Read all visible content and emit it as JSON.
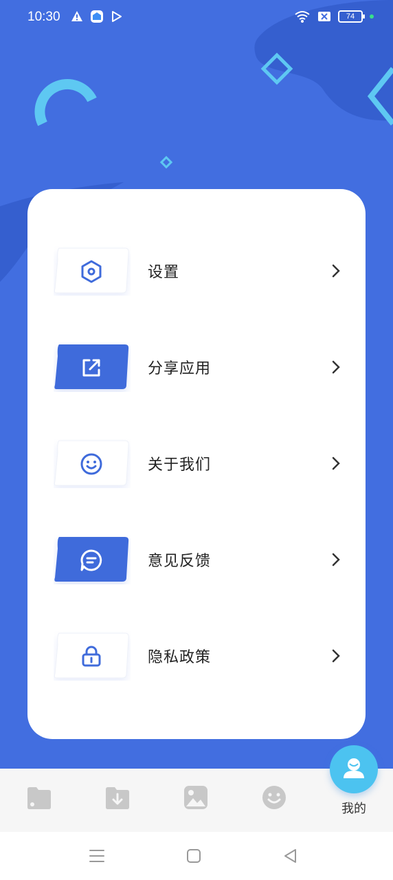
{
  "status_bar": {
    "time": "10:30",
    "battery_level": "74",
    "left_icons": [
      "warning-icon",
      "store-badge-icon",
      "play-store-icon"
    ],
    "right_icons": [
      "wifi-icon",
      "sim-off-icon",
      "battery-icon",
      "charging-dot"
    ]
  },
  "colors": {
    "background": "#426ee0",
    "accent": "#3f6bdb",
    "tab_me_bubble": "#4cc3f0",
    "inactive_tab": "#c8c8c8"
  },
  "menu": {
    "items": [
      {
        "label": "设置",
        "icon": "hexagon-settings-icon",
        "style": "outline"
      },
      {
        "label": "分享应用",
        "icon": "share-external-icon",
        "style": "filled"
      },
      {
        "label": "关于我们",
        "icon": "smiley-face-icon",
        "style": "outline"
      },
      {
        "label": "意见反馈",
        "icon": "chat-bubble-icon",
        "style": "filled"
      },
      {
        "label": "隐私政策",
        "icon": "lock-icon",
        "style": "outline"
      }
    ]
  },
  "tab_bar": {
    "tabs": [
      {
        "icon": "folder-icon"
      },
      {
        "icon": "download-folder-icon"
      },
      {
        "icon": "image-icon"
      },
      {
        "icon": "smiley-icon"
      },
      {
        "icon": "user-icon",
        "label": "我的",
        "active": true
      }
    ]
  },
  "nav_bar": {
    "buttons": [
      "menu-icon",
      "home-square-icon",
      "back-triangle-icon"
    ]
  }
}
